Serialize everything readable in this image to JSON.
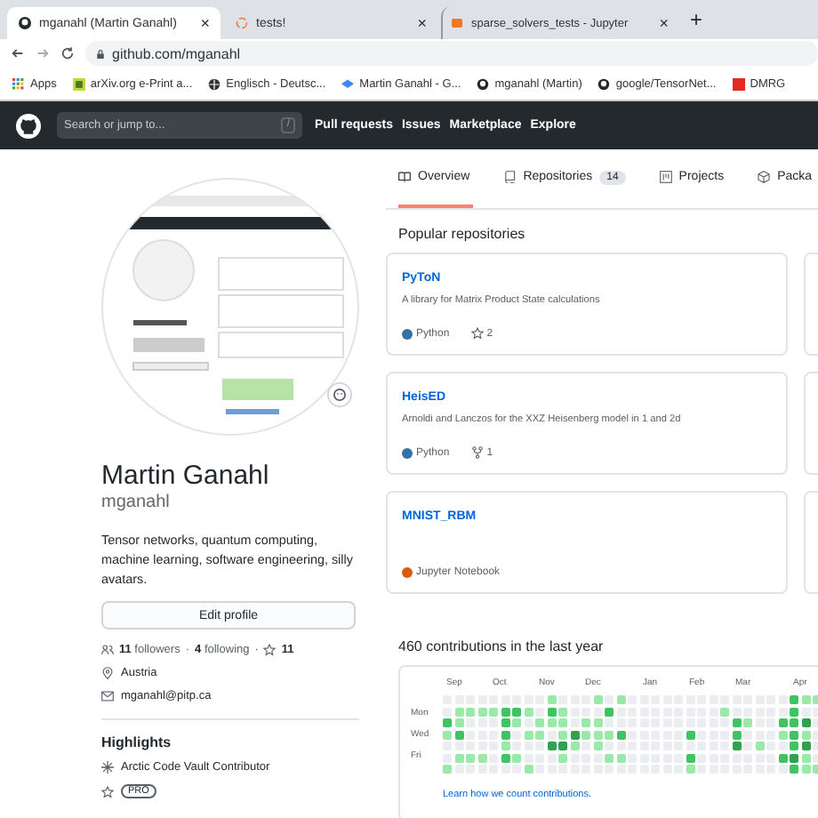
{
  "browser": {
    "tabs": [
      {
        "title": "mganahl (Martin Ganahl)",
        "selected": true,
        "kind": "github",
        "close": "×"
      },
      {
        "title": "tests!",
        "selected": false,
        "kind": "loading",
        "close": "×"
      },
      {
        "title": "sparse_solvers_tests - Jupyter",
        "selected": false,
        "kind": "jupyter",
        "close": "×"
      }
    ],
    "new_tab": "+",
    "url": "github.com/mganahl",
    "bookmarks": [
      {
        "label": "Apps",
        "kind": "apps"
      },
      {
        "label": "arXiv.org e-Print a...",
        "kind": "arxiv"
      },
      {
        "label": "Englisch - Deutsc...",
        "kind": "globe"
      },
      {
        "label": "Martin Ganahl - G...",
        "kind": "scholar"
      },
      {
        "label": "mganahl (Martin)",
        "kind": "github"
      },
      {
        "label": "google/TensorNet...",
        "kind": "github"
      },
      {
        "label": "DMRG",
        "kind": "square"
      }
    ]
  },
  "header": {
    "search": {
      "placeholder": "Search or jump to...",
      "key": "/"
    },
    "nav": [
      "Pull requests",
      "Issues",
      "Marketplace",
      "Explore"
    ]
  },
  "profile": {
    "name": "Martin Ganahl",
    "login": "mganahl",
    "bio": "Tensor networks, quantum computing, machine learning, software engineering, silly avatars.",
    "edit_button": "Edit profile",
    "followers": "11",
    "followers_label": "followers",
    "separator": "·",
    "following": "4",
    "following_label": "following",
    "stars": "11",
    "location": "Austria",
    "email": "mganahl@pitp.ca",
    "highlights_title": "Highlights",
    "highlights": [
      {
        "label": "Arctic Code Vault Contributor",
        "kind": "vault"
      },
      {
        "label": "PRO",
        "kind": "badge"
      }
    ]
  },
  "tabs": [
    {
      "label": "Overview",
      "selected": true,
      "kind": "book"
    },
    {
      "label": "Repositories",
      "count": "14",
      "selected": false,
      "kind": "repo"
    },
    {
      "label": "Projects",
      "selected": false,
      "kind": "project"
    },
    {
      "label": "Packa",
      "selected": false,
      "kind": "package"
    }
  ],
  "popular_title": "Popular repositories",
  "repos": [
    {
      "name": "PyToN",
      "description": "A library for Matrix Product State calculations",
      "language": "Python",
      "color": "#3572a5",
      "stats": [
        {
          "kind": "star",
          "value": "2"
        }
      ]
    },
    {
      "name": "HeisED",
      "description": "Arnoldi and Lanczos for the XXZ Heisenberg model in 1 and 2d",
      "language": "Python",
      "color": "#3572a5",
      "stats": [
        {
          "kind": "fork",
          "value": "1"
        }
      ]
    },
    {
      "name": "MNIST_RBM",
      "language": "Jupyter Notebook",
      "color": "#da5b0b"
    }
  ],
  "contributions": {
    "title": "460 contributions in the last year",
    "months": [
      "Sep",
      "Oct",
      "Nov",
      "Dec",
      "Jan",
      "Feb",
      "Mar",
      "Apr"
    ],
    "days": [
      "Mon",
      "Wed",
      "Fri"
    ],
    "grid": [
      [
        {
          "color": "#ebedf0"
        },
        {
          "color": "#ebedf0"
        },
        {
          "color": "#ebedf0"
        },
        {
          "color": "#ebedf0"
        },
        {
          "color": "#ebedf0"
        },
        {
          "color": "#ebedf0"
        },
        {
          "color": "#ebedf0"
        },
        {
          "color": "#ebedf0"
        },
        {
          "color": "#ebedf0"
        },
        {
          "color": "#9be9a8"
        },
        {
          "color": "#ebedf0"
        },
        {
          "color": "#ebedf0"
        },
        {
          "color": "#ebedf0"
        },
        {
          "color": "#9be9a8"
        },
        {
          "color": "#ebedf0"
        },
        {
          "color": "#9be9a8"
        },
        {
          "color": "#ebedf0"
        },
        {
          "color": "#ebedf0"
        },
        {
          "color": "#ebedf0"
        },
        {
          "color": "#ebedf0"
        },
        {
          "color": "#ebedf0"
        },
        {
          "color": "#ebedf0"
        },
        {
          "color": "#ebedf0"
        },
        {
          "color": "#ebedf0"
        },
        {
          "color": "#ebedf0"
        },
        {
          "color": "#ebedf0"
        },
        {
          "color": "#ebedf0"
        },
        {
          "color": "#ebedf0"
        },
        {
          "color": "#ebedf0"
        },
        {
          "color": "#ebedf0"
        },
        {
          "color": "#40c463"
        },
        {
          "color": "#9be9a8"
        },
        {
          "color": "#9be9a8"
        }
      ],
      [
        {
          "color": "#ebedf0"
        },
        {
          "color": "#9be9a8"
        },
        {
          "color": "#9be9a8"
        },
        {
          "color": "#9be9a8"
        },
        {
          "color": "#9be9a8"
        },
        {
          "color": "#40c463"
        },
        {
          "color": "#40c463"
        },
        {
          "color": "#9be9a8"
        },
        {
          "color": "#ebedf0"
        },
        {
          "color": "#40c463"
        },
        {
          "color": "#9be9a8"
        },
        {
          "color": "#ebedf0"
        },
        {
          "color": "#ebedf0"
        },
        {
          "color": "#ebedf0"
        },
        {
          "color": "#40c463"
        },
        {
          "color": "#ebedf0"
        },
        {
          "color": "#ebedf0"
        },
        {
          "color": "#ebedf0"
        },
        {
          "color": "#ebedf0"
        },
        {
          "color": "#ebedf0"
        },
        {
          "color": "#ebedf0"
        },
        {
          "color": "#ebedf0"
        },
        {
          "color": "#ebedf0"
        },
        {
          "color": "#ebedf0"
        },
        {
          "color": "#9be9a8"
        },
        {
          "color": "#ebedf0"
        },
        {
          "color": "#ebedf0"
        },
        {
          "color": "#ebedf0"
        },
        {
          "color": "#ebedf0"
        },
        {
          "color": "#ebedf0"
        },
        {
          "color": "#40c463"
        },
        {
          "color": "#ebedf0"
        },
        {
          "color": "#ebedf0"
        }
      ],
      [
        {
          "color": "#40c463"
        },
        {
          "color": "#9be9a8"
        },
        {
          "color": "#ebedf0"
        },
        {
          "color": "#ebedf0"
        },
        {
          "color": "#ebedf0"
        },
        {
          "color": "#40c463"
        },
        {
          "color": "#9be9a8"
        },
        {
          "color": "#ebedf0"
        },
        {
          "color": "#9be9a8"
        },
        {
          "color": "#9be9a8"
        },
        {
          "color": "#9be9a8"
        },
        {
          "color": "#ebedf0"
        },
        {
          "color": "#9be9a8"
        },
        {
          "color": "#9be9a8"
        },
        {
          "color": "#ebedf0"
        },
        {
          "color": "#ebedf0"
        },
        {
          "color": "#ebedf0"
        },
        {
          "color": "#ebedf0"
        },
        {
          "color": "#ebedf0"
        },
        {
          "color": "#ebedf0"
        },
        {
          "color": "#ebedf0"
        },
        {
          "color": "#ebedf0"
        },
        {
          "color": "#ebedf0"
        },
        {
          "color": "#ebedf0"
        },
        {
          "color": "#ebedf0"
        },
        {
          "color": "#40c463"
        },
        {
          "color": "#9be9a8"
        },
        {
          "color": "#ebedf0"
        },
        {
          "color": "#ebedf0"
        },
        {
          "color": "#40c463"
        },
        {
          "color": "#40c463"
        },
        {
          "color": "#30a14e"
        },
        {
          "color": "#ebedf0"
        }
      ],
      [
        {
          "color": "#9be9a8"
        },
        {
          "color": "#40c463"
        },
        {
          "color": "#ebedf0"
        },
        {
          "color": "#ebedf0"
        },
        {
          "color": "#ebedf0"
        },
        {
          "color": "#40c463"
        },
        {
          "color": "#ebedf0"
        },
        {
          "color": "#9be9a8"
        },
        {
          "color": "#9be9a8"
        },
        {
          "color": "#ebedf0"
        },
        {
          "color": "#9be9a8"
        },
        {
          "color": "#30a14e"
        },
        {
          "color": "#9be9a8"
        },
        {
          "color": "#9be9a8"
        },
        {
          "color": "#9be9a8"
        },
        {
          "color": "#40c463"
        },
        {
          "color": "#ebedf0"
        },
        {
          "color": "#ebedf0"
        },
        {
          "color": "#ebedf0"
        },
        {
          "color": "#ebedf0"
        },
        {
          "color": "#ebedf0"
        },
        {
          "color": "#40c463"
        },
        {
          "color": "#ebedf0"
        },
        {
          "color": "#ebedf0"
        },
        {
          "color": "#ebedf0"
        },
        {
          "color": "#40c463"
        },
        {
          "color": "#ebedf0"
        },
        {
          "color": "#ebedf0"
        },
        {
          "color": "#ebedf0"
        },
        {
          "color": "#9be9a8"
        },
        {
          "color": "#40c463"
        },
        {
          "color": "#9be9a8"
        },
        {
          "color": "#ebedf0"
        }
      ],
      [
        {
          "color": "#ebedf0"
        },
        {
          "color": "#ebedf0"
        },
        {
          "color": "#ebedf0"
        },
        {
          "color": "#ebedf0"
        },
        {
          "color": "#ebedf0"
        },
        {
          "color": "#9be9a8"
        },
        {
          "color": "#ebedf0"
        },
        {
          "color": "#ebedf0"
        },
        {
          "color": "#ebedf0"
        },
        {
          "color": "#30a14e"
        },
        {
          "color": "#30a14e"
        },
        {
          "color": "#9be9a8"
        },
        {
          "color": "#ebedf0"
        },
        {
          "color": "#9be9a8"
        },
        {
          "color": "#ebedf0"
        },
        {
          "color": "#ebedf0"
        },
        {
          "color": "#ebedf0"
        },
        {
          "color": "#ebedf0"
        },
        {
          "color": "#ebedf0"
        },
        {
          "color": "#ebedf0"
        },
        {
          "color": "#ebedf0"
        },
        {
          "color": "#ebedf0"
        },
        {
          "color": "#ebedf0"
        },
        {
          "color": "#ebedf0"
        },
        {
          "color": "#ebedf0"
        },
        {
          "color": "#30a14e"
        },
        {
          "color": "#ebedf0"
        },
        {
          "color": "#9be9a8"
        },
        {
          "color": "#ebedf0"
        },
        {
          "color": "#ebedf0"
        },
        {
          "color": "#40c463"
        },
        {
          "color": "#30a14e"
        },
        {
          "color": "#ebedf0"
        }
      ],
      [
        {
          "color": "#ebedf0"
        },
        {
          "color": "#9be9a8"
        },
        {
          "color": "#9be9a8"
        },
        {
          "color": "#9be9a8"
        },
        {
          "color": "#ebedf0"
        },
        {
          "color": "#40c463"
        },
        {
          "color": "#9be9a8"
        },
        {
          "color": "#ebedf0"
        },
        {
          "color": "#ebedf0"
        },
        {
          "color": "#ebedf0"
        },
        {
          "color": "#9be9a8"
        },
        {
          "color": "#ebedf0"
        },
        {
          "color": "#ebedf0"
        },
        {
          "color": "#ebedf0"
        },
        {
          "color": "#9be9a8"
        },
        {
          "color": "#9be9a8"
        },
        {
          "color": "#ebedf0"
        },
        {
          "color": "#ebedf0"
        },
        {
          "color": "#ebedf0"
        },
        {
          "color": "#ebedf0"
        },
        {
          "color": "#ebedf0"
        },
        {
          "color": "#40c463"
        },
        {
          "color": "#ebedf0"
        },
        {
          "color": "#ebedf0"
        },
        {
          "color": "#ebedf0"
        },
        {
          "color": "#ebedf0"
        },
        {
          "color": "#ebedf0"
        },
        {
          "color": "#ebedf0"
        },
        {
          "color": "#ebedf0"
        },
        {
          "color": "#40c463"
        },
        {
          "color": "#30a14e"
        },
        {
          "color": "#9be9a8"
        },
        {
          "color": "#ebedf0"
        }
      ],
      [
        {
          "color": "#9be9a8"
        },
        {
          "color": "#ebedf0"
        },
        {
          "color": "#ebedf0"
        },
        {
          "color": "#ebedf0"
        },
        {
          "color": "#ebedf0"
        },
        {
          "color": "#ebedf0"
        },
        {
          "color": "#ebedf0"
        },
        {
          "color": "#9be9a8"
        },
        {
          "color": "#ebedf0"
        },
        {
          "color": "#ebedf0"
        },
        {
          "color": "#ebedf0"
        },
        {
          "color": "#ebedf0"
        },
        {
          "color": "#ebedf0"
        },
        {
          "color": "#ebedf0"
        },
        {
          "color": "#ebedf0"
        },
        {
          "color": "#ebedf0"
        },
        {
          "color": "#ebedf0"
        },
        {
          "color": "#ebedf0"
        },
        {
          "color": "#ebedf0"
        },
        {
          "color": "#ebedf0"
        },
        {
          "color": "#ebedf0"
        },
        {
          "color": "#9be9a8"
        },
        {
          "color": "#ebedf0"
        },
        {
          "color": "#ebedf0"
        },
        {
          "color": "#ebedf0"
        },
        {
          "color": "#ebedf0"
        },
        {
          "color": "#ebedf0"
        },
        {
          "color": "#ebedf0"
        },
        {
          "color": "#ebedf0"
        },
        {
          "color": "#ebedf0"
        },
        {
          "color": "#40c463"
        },
        {
          "color": "#9be9a8"
        },
        {
          "color": "#9be9a8"
        }
      ]
    ],
    "link": "Learn how we count contributions."
  }
}
